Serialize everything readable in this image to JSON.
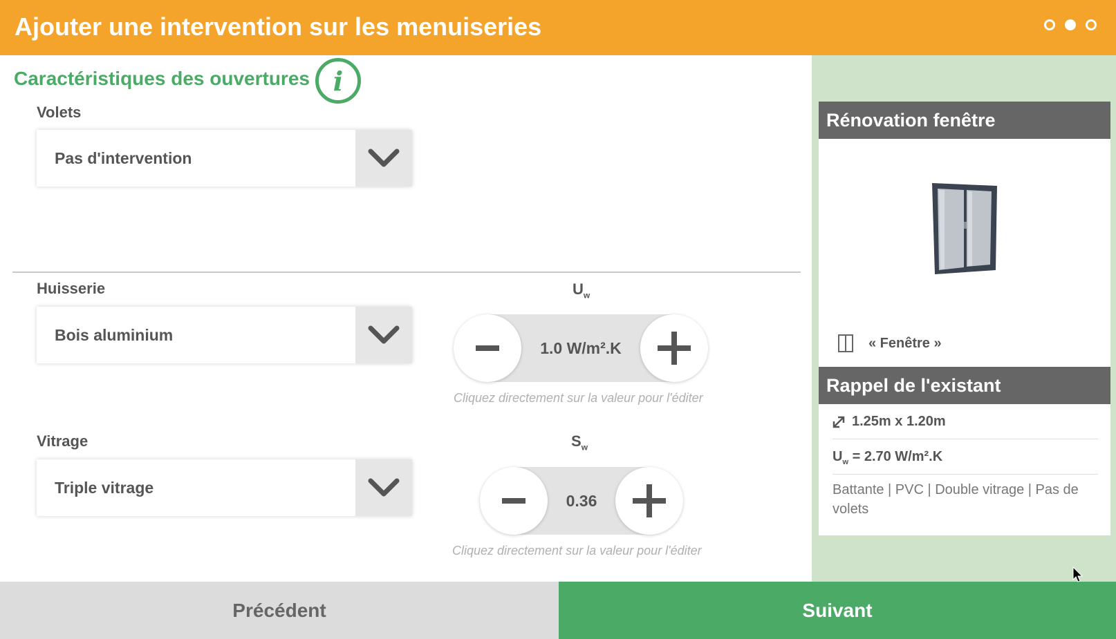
{
  "header": {
    "title": "Ajouter une intervention sur les menuiseries",
    "steps": [
      {
        "active": false
      },
      {
        "active": true
      },
      {
        "active": false
      }
    ]
  },
  "section": {
    "title": "Caractéristiques des ouvertures",
    "info_icon_glyph": "i"
  },
  "volets": {
    "label": "Volets",
    "value": "Pas d'intervention"
  },
  "huisserie": {
    "label": "Huisserie",
    "value": "Bois aluminium"
  },
  "vitrage": {
    "label": "Vitrage",
    "value": "Triple vitrage"
  },
  "uw_stepper": {
    "label_main": "U",
    "label_sub": "w",
    "value": "1.0 W/m².K",
    "hint": "Cliquez directement sur la valeur pour l'éditer"
  },
  "sw_stepper": {
    "label_main": "S",
    "label_sub": "w",
    "value": "0.36",
    "hint": "Cliquez directement sur la valeur pour l'éditer"
  },
  "renovation_card": {
    "title": "Rénovation fenêtre",
    "window_label": "« Fenêtre »"
  },
  "existing_card": {
    "title": "Rappel de l'existant",
    "dimensions": "1.25m x 1.20m",
    "uw_label_main": "U",
    "uw_label_sub": "w",
    "uw_value": "=  2.70 W/m².K",
    "description": "Battante | PVC | Double vitrage | Pas de volets"
  },
  "footer": {
    "prev_label": "Précédent",
    "next_label": "Suivant"
  },
  "colors": {
    "header_orange": "#f4a42a",
    "accent_green": "#4aaa66",
    "side_panel_green": "#cfe2ca",
    "card_header_gray": "#666666"
  },
  "icons": {
    "chevron": "chevron-down-icon",
    "minus": "minus-icon",
    "plus": "plus-icon",
    "window_small": "window-icon",
    "resize": "resize-arrow-icon"
  }
}
